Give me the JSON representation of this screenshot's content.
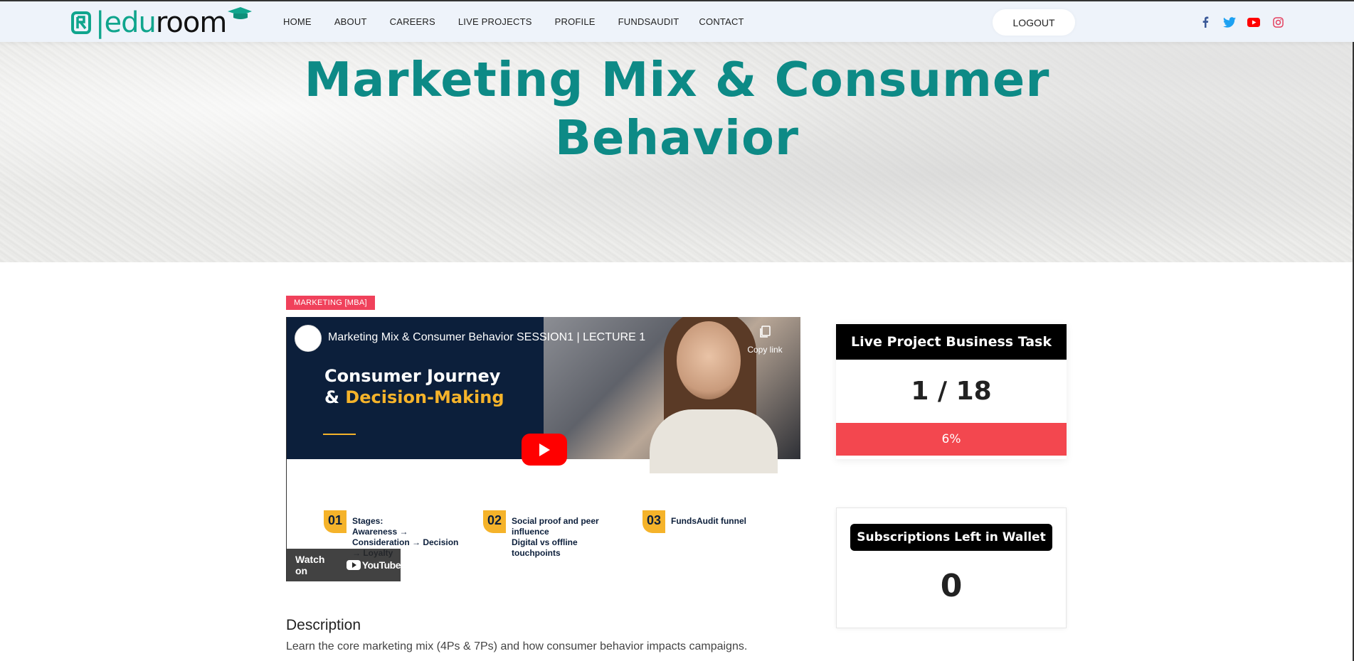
{
  "nav": {
    "logo_left": "|edu",
    "logo_right": "room",
    "items": [
      "HOME",
      "ABOUT",
      "CAREERS",
      "LIVE PROJECTS",
      "PROFILE",
      "FUNDSAUDIT",
      "CONTACT"
    ],
    "logout_label": "LOGOUT",
    "socials": [
      "facebook-icon",
      "twitter-icon",
      "youtube-icon",
      "instagram-icon"
    ]
  },
  "hero": {
    "title_line1": "Marketing Mix & Consumer",
    "title_line2": "Behavior"
  },
  "course": {
    "category": "MARKETING [MBA]",
    "video": {
      "title": "Marketing Mix & Consumer Behavior SESSION1 | LECTURE 1",
      "copy_link": "Copy link",
      "slide_heading_1": "Consumer Journey",
      "slide_heading_2a": "& ",
      "slide_heading_2b": "Decision-Making",
      "steps": [
        {
          "num": "01",
          "text": "Stages:\nAwareness →\nConsideration → Decision\n→ Loyalty"
        },
        {
          "num": "02",
          "text": "Social proof and peer\ninfluence\nDigital vs offline\ntouchpoints"
        },
        {
          "num": "03",
          "text": "FundsAudit funnel"
        }
      ],
      "watch_on": "Watch on",
      "youtube": "YouTube"
    },
    "description_heading": "Description",
    "description_text": "Learn the core marketing mix (4Ps & 7Ps) and how consumer behavior impacts campaigns."
  },
  "task_card": {
    "title": "Live Project Business Task",
    "count": "1 / 18",
    "progress_label": "6%",
    "progress_fraction": 0.06
  },
  "wallet_card": {
    "title": "Subscriptions Left in Wallet",
    "count": "0"
  },
  "colors": {
    "brand_teal": "#0d8a86",
    "badge_red": "#f0415b",
    "progress_red": "#f3474f"
  }
}
